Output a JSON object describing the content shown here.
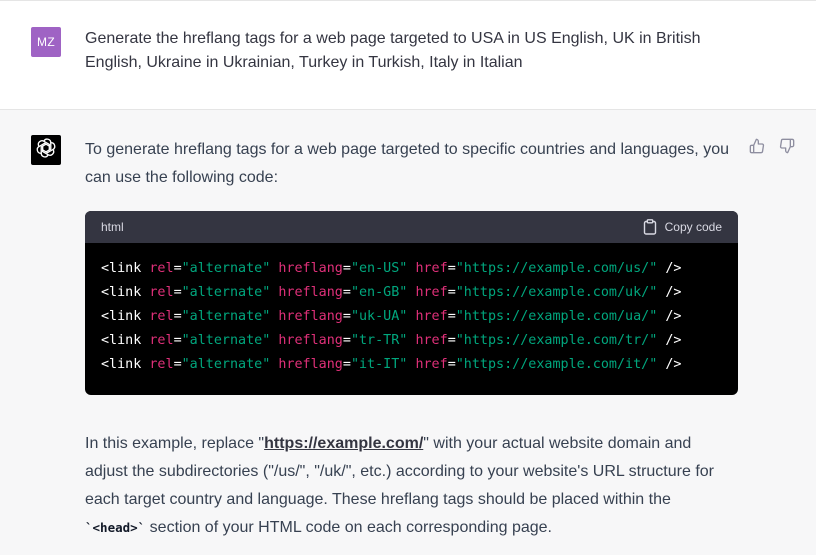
{
  "user_message": {
    "avatar_initials": "MZ",
    "avatar_color": "#9f63c4",
    "text": "Generate the hreflang tags for a web page targeted to USA in US English, UK in British English, Ukraine in Ukrainian, Turkey in Turkish, Italy in Italian"
  },
  "assistant_message": {
    "avatar_icon": "openai-logo-icon",
    "intro": "To generate hreflang tags for a web page targeted to specific countries and languages, you can use the following code:",
    "code_block": {
      "language": "html",
      "copy_label": "Copy code",
      "lines": [
        {
          "tag_open": "<link ",
          "rel_attr": "rel",
          "rel_value": "\"alternate\"",
          "hreflang_attr": "hreflang",
          "hreflang_value": "\"en-US\"",
          "href_attr": "href",
          "href_value": "\"https://example.com/us/\"",
          "tag_close": " />"
        },
        {
          "tag_open": "<link ",
          "rel_attr": "rel",
          "rel_value": "\"alternate\"",
          "hreflang_attr": "hreflang",
          "hreflang_value": "\"en-GB\"",
          "href_attr": "href",
          "href_value": "\"https://example.com/uk/\"",
          "tag_close": " />"
        },
        {
          "tag_open": "<link ",
          "rel_attr": "rel",
          "rel_value": "\"alternate\"",
          "hreflang_attr": "hreflang",
          "hreflang_value": "\"uk-UA\"",
          "href_attr": "href",
          "href_value": "\"https://example.com/ua/\"",
          "tag_close": " />"
        },
        {
          "tag_open": "<link ",
          "rel_attr": "rel",
          "rel_value": "\"alternate\"",
          "hreflang_attr": "hreflang",
          "hreflang_value": "\"tr-TR\"",
          "href_attr": "href",
          "href_value": "\"https://example.com/tr/\"",
          "tag_close": " />"
        },
        {
          "tag_open": "<link ",
          "rel_attr": "rel",
          "rel_value": "\"alternate\"",
          "hreflang_attr": "hreflang",
          "hreflang_value": "\"it-IT\"",
          "href_attr": "href",
          "href_value": "\"https://example.com/it/\"",
          "tag_close": " />"
        }
      ]
    },
    "outro": {
      "part1": "In this example, replace \"",
      "link_text": "https://example.com/",
      "part2": "\" with your actual website domain and adjust the subdirectories (\"/us/\", \"/uk/\", etc.) according to your website's URL structure for each target country and language. These hreflang tags should be placed within the ",
      "inline_code": "`<head>`",
      "part3": " section of your HTML code on each corresponding page."
    },
    "feedback": {
      "thumbs_up_icon": "thumbs-up-icon",
      "thumbs_down_icon": "thumbs-down-icon"
    }
  },
  "colors": {
    "page_bg": "#f7f7f8",
    "user_bg": "#ffffff",
    "code_bg": "#000000",
    "code_header_bg": "#343541",
    "code_tag": "#ffffff",
    "code_attr": "#df3079",
    "code_string": "#00a67d"
  }
}
